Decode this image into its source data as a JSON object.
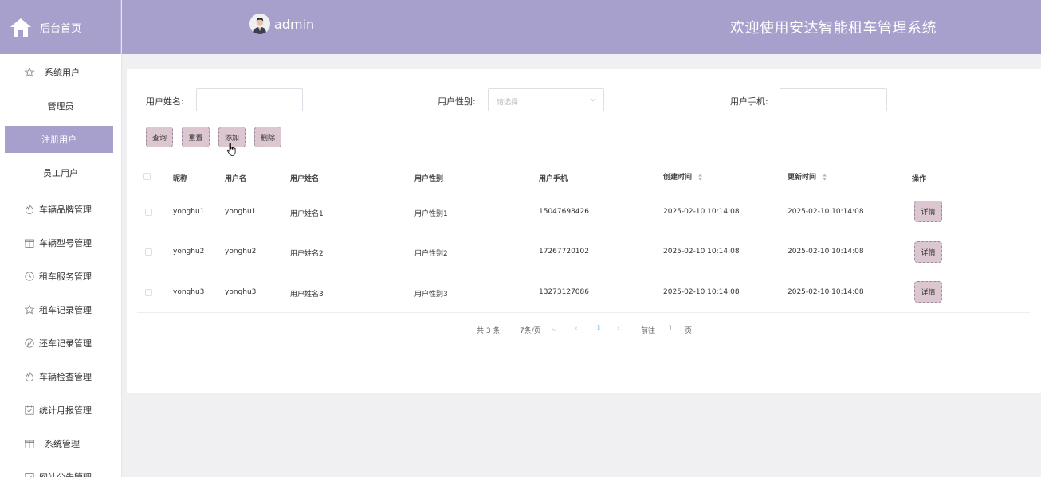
{
  "sidebar": {
    "brand": "后台首页",
    "items": [
      {
        "label": "系统用户",
        "icon": "star-icon",
        "type": "group"
      },
      {
        "label": "管理员",
        "type": "sub"
      },
      {
        "label": "注册用户",
        "type": "sub",
        "active": true
      },
      {
        "label": "员工用户",
        "type": "sub"
      },
      {
        "label": "车辆品牌管理",
        "icon": "fire-icon",
        "type": "group"
      },
      {
        "label": "车辆型号管理",
        "icon": "gift-icon",
        "type": "group"
      },
      {
        "label": "租车服务管理",
        "icon": "refresh-icon",
        "type": "group"
      },
      {
        "label": "租车记录管理",
        "icon": "star-icon",
        "type": "group"
      },
      {
        "label": "还车记录管理",
        "icon": "compass-icon",
        "type": "group"
      },
      {
        "label": "车辆检查管理",
        "icon": "fire-icon",
        "type": "group"
      },
      {
        "label": "统计月报管理",
        "icon": "calendar-check-icon",
        "type": "group"
      },
      {
        "label": "系统管理",
        "icon": "gift-icon",
        "type": "group"
      },
      {
        "label": "网站公告管理",
        "icon": "calendar-check-icon",
        "type": "group"
      }
    ]
  },
  "header": {
    "username": "admin",
    "welcome": "欢迎使用安达智能租车管理系统"
  },
  "filters": {
    "name_label": "用户姓名:",
    "name_value": "",
    "gender_label": "用户性别:",
    "gender_placeholder": "请选择",
    "phone_label": "用户手机:",
    "phone_value": ""
  },
  "actions": {
    "query": "查询",
    "reset": "重置",
    "add": "添加",
    "delete": "删除"
  },
  "table": {
    "headers": [
      "昵称",
      "用户名",
      "用户姓名",
      "用户性别",
      "用户手机",
      "创建时间",
      "更新时间",
      "操作"
    ],
    "detail_label": "详情",
    "rows": [
      {
        "nickname": "yonghu1",
        "username": "yonghu1",
        "name": "用户姓名1",
        "gender": "用户性别1",
        "phone": "15047698426",
        "created": "2025-02-10 10:14:08",
        "updated": "2025-02-10 10:14:08"
      },
      {
        "nickname": "yonghu2",
        "username": "yonghu2",
        "name": "用户姓名2",
        "gender": "用户性别2",
        "phone": "17267720102",
        "created": "2025-02-10 10:14:08",
        "updated": "2025-02-10 10:14:08"
      },
      {
        "nickname": "yonghu3",
        "username": "yonghu3",
        "name": "用户姓名3",
        "gender": "用户性别3",
        "phone": "13273127086",
        "created": "2025-02-10 10:14:08",
        "updated": "2025-02-10 10:14:08"
      }
    ]
  },
  "pagination": {
    "total": "共 3 条",
    "page_size": "7条/页",
    "current_page": "1",
    "goto_label": "前往",
    "goto_value": "1",
    "page_suffix": "页"
  },
  "colors": {
    "accent": "#a79fcc",
    "button_fill": "#dcc7d1",
    "link_blue": "#409eff"
  }
}
